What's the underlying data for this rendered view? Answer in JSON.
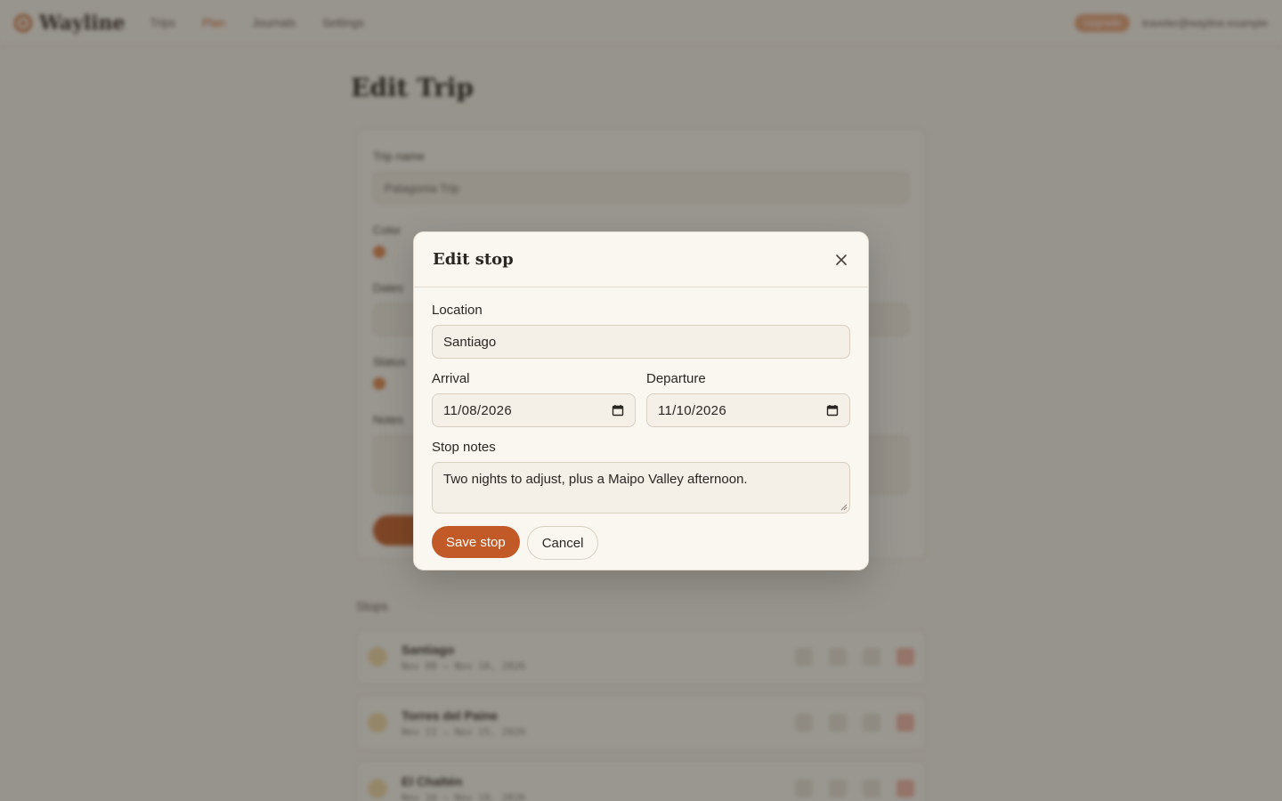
{
  "background": {
    "brand": "Wayline",
    "nav": [
      "Trips",
      "Plan",
      "Journals",
      "Settings"
    ],
    "nav_active": "Plan",
    "badge": "Upgrade",
    "user": "traveler@wayline.example",
    "page_title": "Edit Trip",
    "form": {
      "trip_name_label": "Trip name",
      "trip_name_value": "Patagonia Trip",
      "color_label": "Color",
      "dates_label": "Dates",
      "status_label": "Status",
      "notes_label": "Notes"
    },
    "stops_heading": "Stops",
    "stops": [
      {
        "name": "Santiago",
        "dates": "Nov 08 – Nov 10, 2026"
      },
      {
        "name": "Torres del Paine",
        "dates": "Nov 11 – Nov 15, 2026"
      },
      {
        "name": "El Chaltén",
        "dates": "Nov 16 – Nov 19, 2026"
      }
    ]
  },
  "modal": {
    "title": "Edit stop",
    "close_icon": "close-icon",
    "location_label": "Location",
    "location_value": "Santiago",
    "arrival_label": "Arrival",
    "arrival_value": "11/08/2026",
    "departure_label": "Departure",
    "departure_value": "11/10/2026",
    "notes_label": "Stop notes",
    "notes_value": "Two nights to adjust, plus a Maipo Valley afternoon.",
    "save_label": "Save stop",
    "cancel_label": "Cancel"
  },
  "colors": {
    "accent": "#c25a27",
    "background": "#f6f2ea",
    "modal_bg": "#faf7f1",
    "border": "#d8cfc1"
  }
}
